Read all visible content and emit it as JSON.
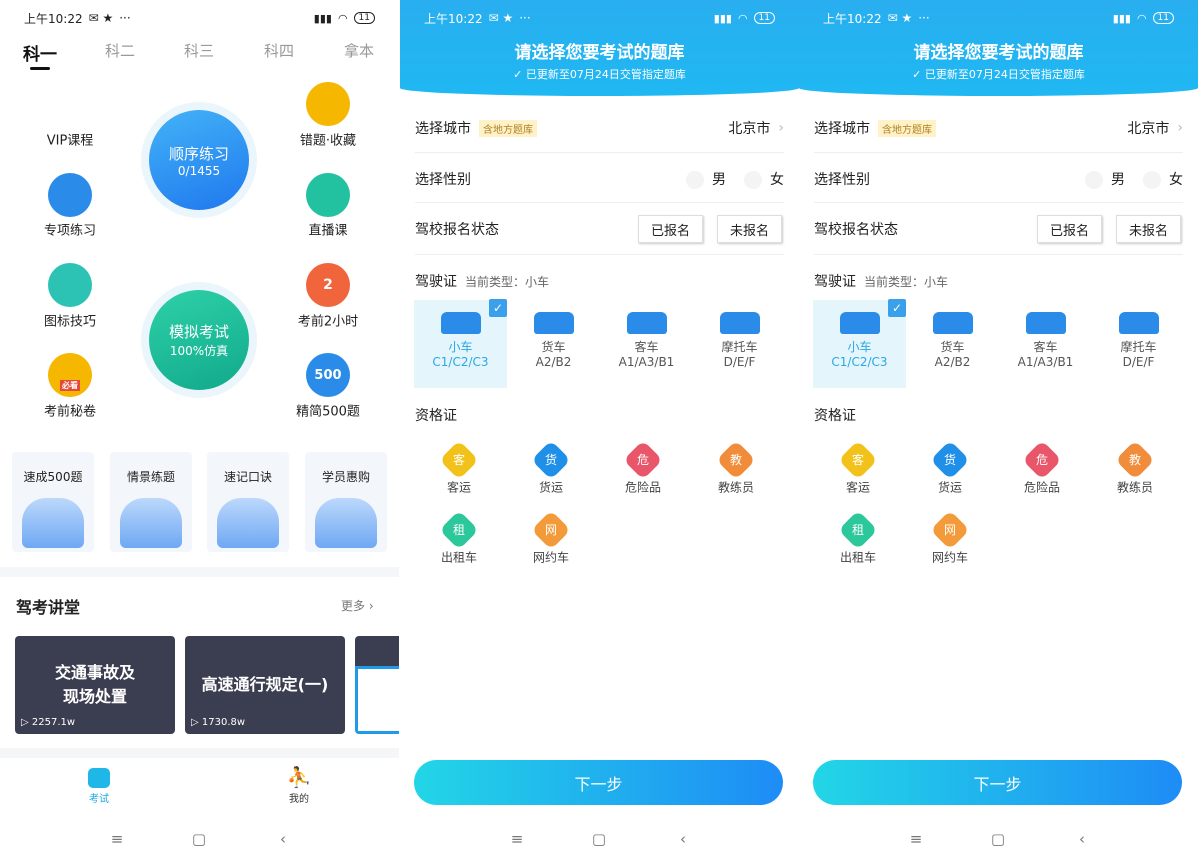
{
  "status_bar": {
    "time": "上午10:22",
    "more": "···",
    "battery": "11"
  },
  "home": {
    "tabs": [
      "科一",
      "科二",
      "科三",
      "科四",
      "拿本"
    ],
    "sequential": {
      "label": "顺序练习",
      "progress": "0/1455",
      "color": "#2f8ff0"
    },
    "mock": {
      "label": "模拟考试",
      "sub": "100%仿真",
      "color": "#1fbf9a"
    },
    "features_left": [
      {
        "label": "VIP课程",
        "icon": "vip-icon",
        "color": ""
      },
      {
        "label": "专项练习",
        "icon": "target-icon",
        "color": "#2a8ce8"
      },
      {
        "label": "图标技巧",
        "icon": "grid-icon",
        "color": "#2cc3b5"
      },
      {
        "label": "考前秘卷",
        "icon": "paper-icon",
        "color": "#f5b700",
        "badge": "必看"
      }
    ],
    "features_right": [
      {
        "label": "错题·收藏",
        "icon": "folder-icon",
        "color": "#f5b700"
      },
      {
        "label": "直播课",
        "icon": "camera-icon",
        "color": "#22c1a0"
      },
      {
        "label": "考前2小时",
        "icon": "clock-icon",
        "color": "#f0653c",
        "glyph": "2"
      },
      {
        "label": "精简500题",
        "icon": "500-icon",
        "color": "#2a8ce8",
        "glyph": "500"
      }
    ],
    "cards": [
      "速成500题",
      "情景练题",
      "速记口诀",
      "学员惠购"
    ],
    "lecture": {
      "title": "驾考讲堂",
      "more": "更多",
      "videos": [
        {
          "title": "交通事故及\n现场处置",
          "views": "2257.1w"
        },
        {
          "title": "高速通行规定(一)",
          "views": "1730.8w"
        }
      ]
    },
    "bottom_tabs": [
      {
        "label": "考试",
        "active": true
      },
      {
        "label": "我的",
        "active": false
      }
    ]
  },
  "select": {
    "header": {
      "title": "请选择您要考试的题库",
      "subtitle": "已更新至07月24日交管指定题库"
    },
    "city": {
      "label": "选择城市",
      "badge": "含地方题库",
      "value": "北京市"
    },
    "gender": {
      "label": "选择性别",
      "options": [
        "男",
        "女"
      ]
    },
    "school": {
      "label": "驾校报名状态",
      "options": [
        "已报名",
        "未报名"
      ]
    },
    "license": {
      "label": "驾驶证",
      "current": "当前类型：小车",
      "types": [
        {
          "name": "小车",
          "code": "C1/C2/C3",
          "selected": true
        },
        {
          "name": "货车",
          "code": "A2/B2"
        },
        {
          "name": "客车",
          "code": "A1/A3/B1"
        },
        {
          "name": "摩托车",
          "code": "D/E/F"
        }
      ]
    },
    "cert": {
      "label": "资格证",
      "items": [
        {
          "name": "客运",
          "glyph": "客",
          "color": "#f3c21a"
        },
        {
          "name": "货运",
          "glyph": "货",
          "color": "#1f8fe8"
        },
        {
          "name": "危险品",
          "glyph": "危",
          "color": "#e9566a"
        },
        {
          "name": "教练员",
          "glyph": "教",
          "color": "#f08c3a"
        },
        {
          "name": "出租车",
          "glyph": "租",
          "color": "#2cc79a"
        },
        {
          "name": "网约车",
          "glyph": "网",
          "color": "#f39a3a"
        }
      ]
    },
    "next": "下一步"
  },
  "nav": {
    "menu": "≡",
    "home": "▢",
    "back": "‹"
  }
}
